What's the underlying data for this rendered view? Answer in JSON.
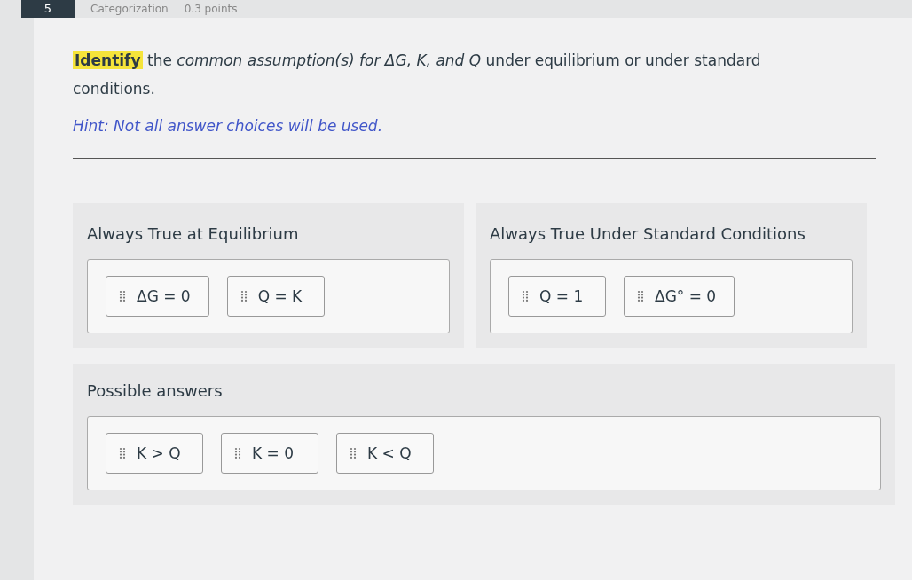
{
  "header": {
    "number": "5",
    "type": "Categorization",
    "points": "0.3 points"
  },
  "question": {
    "highlighted": "Identify",
    "text": "the *common assumption(s) for ΔG, K, and Q* under equilibrium or under standard conditions."
  },
  "hint": "Hint: Not all answer choices will be used.",
  "categories": [
    {
      "title": "Always True at Equilibrium",
      "items": [
        "ΔG = 0",
        "Q = K"
      ]
    },
    {
      "title": "Always True Under Standard Conditions",
      "items": [
        "Q = 1",
        "ΔG° = 0"
      ]
    }
  ],
  "possible_answers": {
    "title": "Possible answers",
    "items": [
      "K > Q",
      "K = 0",
      "K < Q"
    ]
  }
}
